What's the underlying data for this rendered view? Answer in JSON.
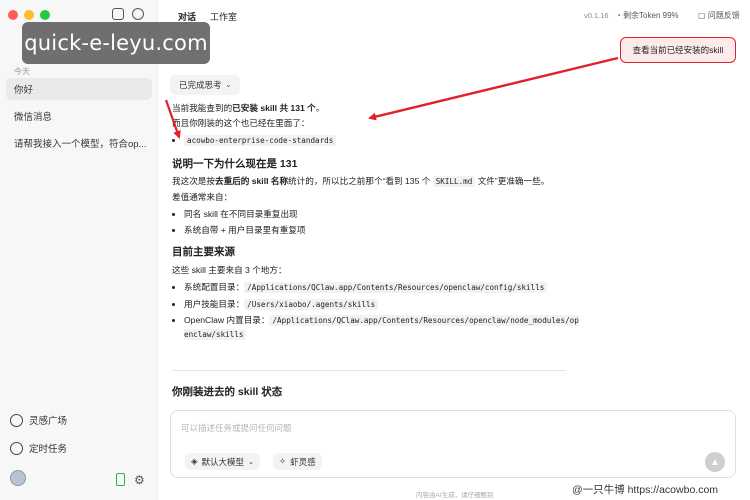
{
  "watermark": "quick-e-leyu.com",
  "sidebar": {
    "section_label": "今天",
    "items": [
      {
        "label": "你好"
      },
      {
        "label": "微信消息"
      },
      {
        "label": "请帮我接入一个模型，符合op..."
      }
    ],
    "bottom": {
      "inspiration": "灵感广场",
      "scheduled": "定时任务"
    }
  },
  "topbar": {
    "tabs": [
      {
        "label": "对话"
      },
      {
        "label": "工作室"
      }
    ],
    "version": "v0.1.16",
    "token": "剩余Token 99%",
    "feedback": "问题反馈"
  },
  "chat": {
    "user_message": "查看当前已经安装的skill",
    "think_label": "已完成思考",
    "intro_line1_pre": "当前我能查到的",
    "intro_line1_bold": "已安装 skill 共 131 个",
    "intro_line1_post": "。",
    "intro_line2": "而且你刚装的这个也已经在里面了：",
    "installed_skill": "acowbo-enterprise-code-standards",
    "heading1": "说明一下为什么现在是 131",
    "explain_pre": "我这次是按",
    "explain_bold": "去重后的 skill 名称",
    "explain_mid": "统计的，所以比之前那个“看到 135 个 ",
    "explain_code": "SKILL.md",
    "explain_post": " 文件”更准确一些。",
    "diff_line": "差值通常来自：",
    "reasons": [
      "同名 skill 在不同目录重复出现",
      "系统自带 + 用户目录里有重复项"
    ],
    "heading2": "目前主要来源",
    "sources_intro": "这些 skill 主要来自 3 个地方：",
    "sources": [
      {
        "label": "系统配置目录：",
        "path": "/Applications/QClaw.app/Contents/Resources/openclaw/config/skills"
      },
      {
        "label": "用户技能目录：",
        "path": "/Users/xiaobo/.agents/skills"
      },
      {
        "label": "OpenClaw 内置目录：",
        "path": "/Applications/QClaw.app/Contents/Resources/openclaw/node_modules/openclaw/skills"
      }
    ],
    "heading3": "你刚装进去的 skill 状态"
  },
  "composer": {
    "placeholder": "可以描述任务或提问任何问题",
    "model_label": "默认大模型",
    "skill_label": "虾灵感"
  },
  "footer": {
    "disclaimer": "内容由AI生成，请仔细甄别",
    "credit": "@一只牛博 https://acowbo.com"
  },
  "colors": {
    "accent_red": "#e0202b",
    "bubble_bg": "#fdeaea"
  }
}
